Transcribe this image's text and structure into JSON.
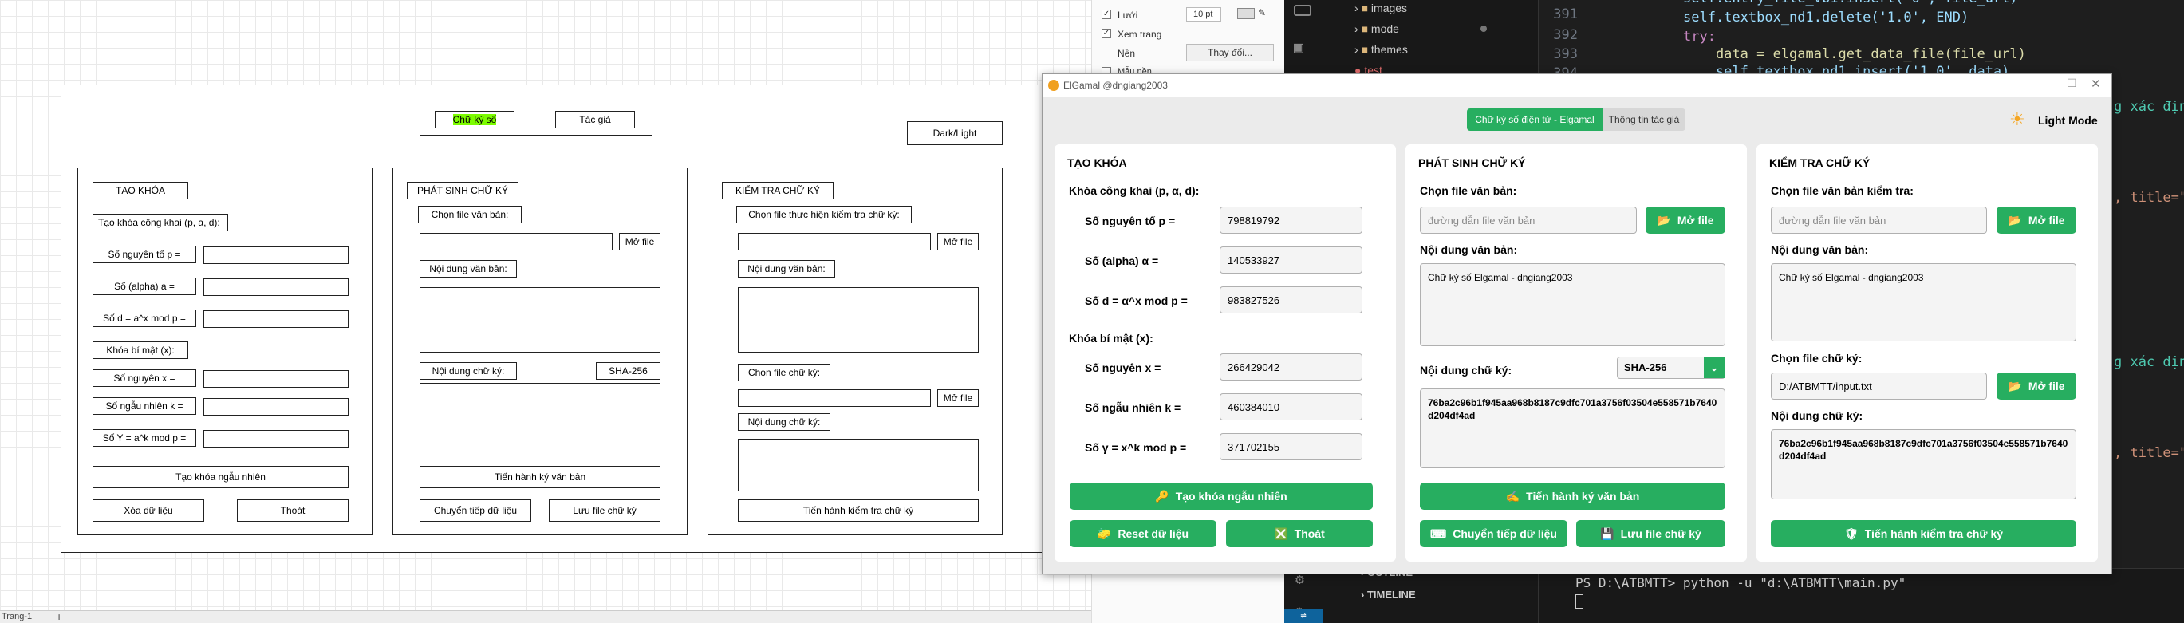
{
  "drawio": {
    "tab_chu_ky": "Chữ ký số",
    "tab_tac_gia": "Tác giả",
    "dark_light": "Dark/Light",
    "tao_khoa": "TẠO KHÓA",
    "khoa_cong_khai": "Tạo khóa công khai (p, a, d):",
    "so_nguyen_to": "Số nguyên tố p =",
    "so_alpha": "Số (alpha) a =",
    "so_d": "Số d = a^x mod p =",
    "khoa_bi_mat": "Khóa bí mật (x):",
    "so_nguyen_x": "Số nguyên x =",
    "so_ngau_nhien": "Số ngẫu nhiên k =",
    "so_y": "Số Y = a^k mod p =",
    "tao_khoa_nn": "Tạo khóa ngẫu nhiên",
    "xoa_du_lieu": "Xóa dữ liệu",
    "thoat": "Thoát",
    "phat_sinh": "PHÁT SINH CHỮ KÝ",
    "chon_file_vb": "Chọn file văn bản:",
    "mo_file": "Mở file",
    "noi_dung_vb": "Nội dung văn bản:",
    "noi_dung_ck": "Nội dung chữ ký:",
    "sha": "SHA-256",
    "tien_hanh_ky": "Tiến hành ký văn bản",
    "chuyen_tiep": "Chuyển tiếp dữ liệu",
    "luu_file": "Lưu file chữ ký",
    "kiem_tra": "KIỂM TRA CHỮ KÝ",
    "chon_file_kt": "Chọn file thực hiện kiểm tra chữ ký:",
    "chon_file_ck": "Chọn file chữ ký:",
    "tien_hanh_kt": "Tiến hành kiểm tra chữ ký",
    "page_tab": "Trang-1"
  },
  "format_panel": {
    "luoi": "Lưới",
    "grid_size": "10 pt",
    "xem_trang": "Xem trang",
    "nen": "Nền",
    "thay_doi": "Thay đổi...",
    "mau_nen": "Mẫu nền"
  },
  "vscode": {
    "explorer": [
      "images",
      "mode",
      "themes",
      "test"
    ],
    "line_numbers": [
      "391",
      "392",
      "393",
      "394"
    ],
    "code": [
      "self.entry_file_vb1.insert('0', file_url)",
      "self.textbox_nd1.delete('1.0', END)",
      "try:",
      "    data = elgamal.get_data_file(file_url)",
      "    self.textbox_nd1.insert('1.0', data)"
    ],
    "right_frag1": "g xác địn",
    "right_frag2": ", title=\"",
    "right_frag3": "g xác địn",
    "right_frag4": ", title=\"",
    "outline": "OUTLINE",
    "timeline": "TIMELINE",
    "terminal": "PS D:\\ATBMTT> python -u \"d:\\ATBMTT\\main.py\""
  },
  "app": {
    "title": "ElGamal @dngiang2003",
    "tab_active": "Chữ ký số điện tử - Elgamal",
    "tab_info": "Thông tin tác giả",
    "light_mode": "Light Mode",
    "c1": {
      "title": "TẠO KHÓA",
      "public_label": "Khóa công khai (p, α, d):",
      "p_label": "Số nguyên tố p =",
      "p": "798819792",
      "a_label": "Số (alpha) α =",
      "a": "140533927",
      "d_label": "Số d = α^x mod p =",
      "d": "983827526",
      "private_label": "Khóa bí mật (x):",
      "x_label": "Số nguyên x =",
      "x": "266429042",
      "k_label": "Số ngẫu nhiên k =",
      "k": "460384010",
      "y_label": "Số γ = x^k mod p =",
      "y": "371702155",
      "btn_gen": "Tạo khóa ngẫu nhiên",
      "btn_reset": "Reset dữ liệu",
      "btn_exit": "Thoát"
    },
    "c2": {
      "title": "PHÁT SINH CHỮ KÝ",
      "file_label": "Chọn file văn bản:",
      "file_ph": "đường dẫn file văn bản",
      "btn_open": "Mở file",
      "content_label": "Nội dung văn bản:",
      "content": "Chữ ký số Elgamal - dngiang2003",
      "sig_label": "Nội dung chữ ký:",
      "hash": "SHA-256",
      "sig": "76ba2c96b1f945aa968b8187c9dfc701a3756f03504e558571b7640d204df4ad",
      "btn_sign": "Tiến hành ký văn bản",
      "btn_forward": "Chuyển tiếp dữ liệu",
      "btn_save": "Lưu file chữ ký"
    },
    "c3": {
      "title": "KIỂM TRA CHỮ KÝ",
      "file_label": "Chọn file văn bản kiểm tra:",
      "file_ph": "đường dẫn file văn bản",
      "btn_open": "Mở file",
      "content_label": "Nội dung văn bản:",
      "content": "Chữ ký số Elgamal - dngiang2003",
      "sigfile_label": "Chọn file chữ ký:",
      "sigfile": "D:/ATBMTT/input.txt",
      "btn_open2": "Mở file",
      "sig_label": "Nội dung chữ ký:",
      "sig": "76ba2c96b1f945aa968b8187c9dfc701a3756f03504e558571b7640d204df4ad",
      "btn_verify": "Tiến hành kiểm tra chữ ký"
    }
  },
  "colors": {
    "accent": "#27ae60",
    "tab_active": "#27ae60"
  }
}
